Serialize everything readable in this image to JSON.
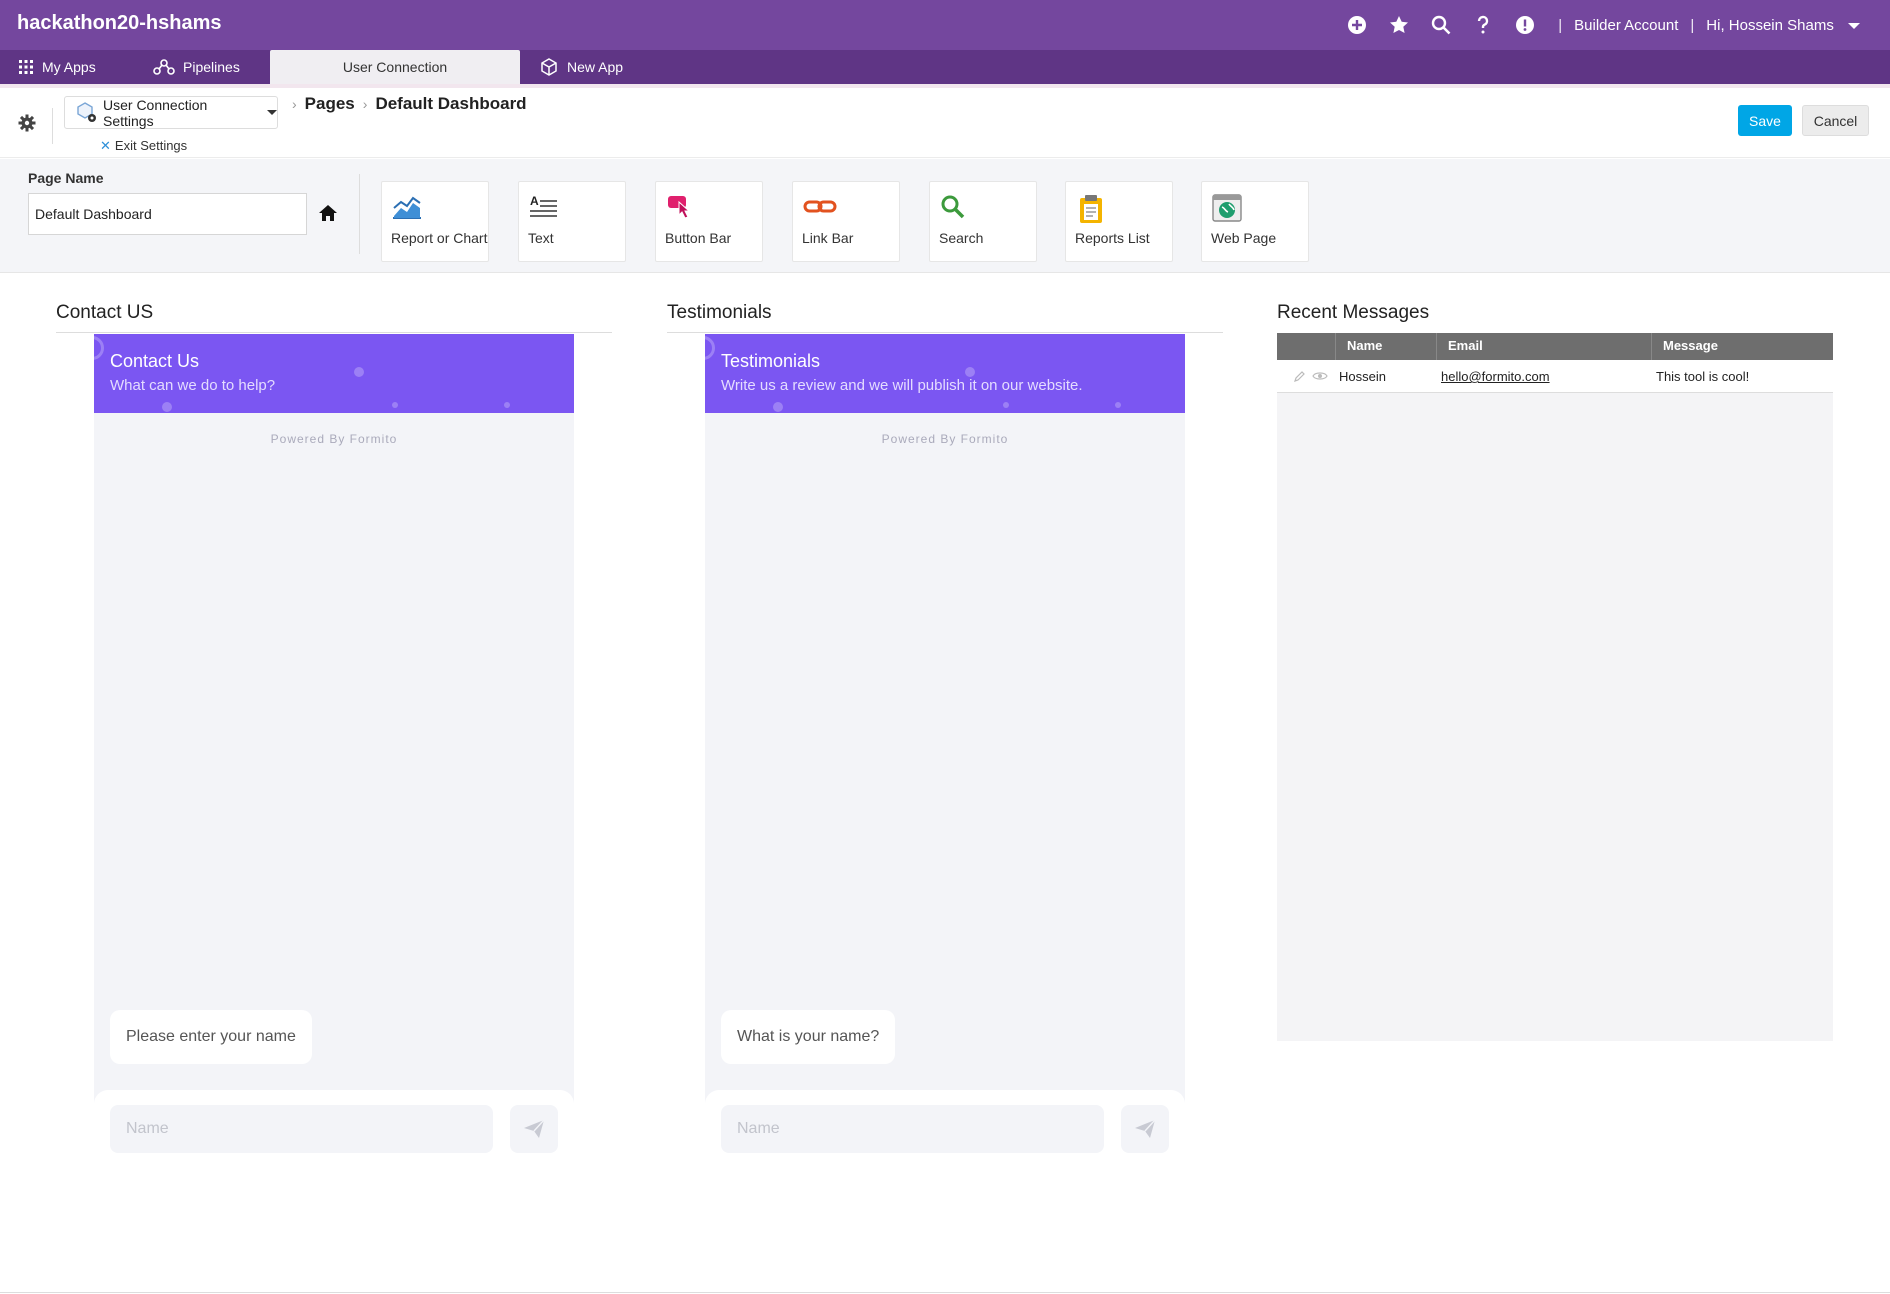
{
  "app": {
    "name": "hackathon20-hshams",
    "account_label": "Builder Account",
    "user_greeting": "Hi, Hossein Shams",
    "separator": "|",
    "icons": [
      "add-circle-icon",
      "star-icon",
      "search-icon",
      "help-icon",
      "alert-icon"
    ]
  },
  "tabs": [
    {
      "label": "My Apps",
      "icon": "grid-icon"
    },
    {
      "label": "Pipelines",
      "icon": "pipelines-icon"
    },
    {
      "label": "User Connection",
      "active": true
    },
    {
      "label": "New App",
      "icon": "cube-icon"
    }
  ],
  "settings": {
    "connection_select": "User Connection Settings",
    "exit_label": "Exit Settings",
    "breadcrumb": [
      "Pages",
      "Default Dashboard"
    ],
    "save_label": "Save",
    "cancel_label": "Cancel"
  },
  "widgets": {
    "page_name_label": "Page Name",
    "page_name_value": "Default Dashboard",
    "items": [
      {
        "label": "Report or Chart",
        "icon": "chart-icon"
      },
      {
        "label": "Text",
        "icon": "text-icon"
      },
      {
        "label": "Button Bar",
        "icon": "button-bar-icon"
      },
      {
        "label": "Link Bar",
        "icon": "link-icon"
      },
      {
        "label": "Search",
        "icon": "search-icon"
      },
      {
        "label": "Reports List",
        "icon": "clipboard-icon"
      },
      {
        "label": "Web Page",
        "icon": "globe-icon"
      }
    ]
  },
  "panels": {
    "contact": {
      "title": "Contact US",
      "form_title": "Contact Us",
      "form_subtitle": "What can we do to help?",
      "powered": "Powered By Formito",
      "question": "Please enter your name",
      "input_placeholder": "Name"
    },
    "testimonials": {
      "title": "Testimonials",
      "form_title": "Testimonials",
      "form_subtitle": "Write us a review and we will publish it on our website.",
      "powered": "Powered By Formito",
      "question": "What is your name?",
      "input_placeholder": "Name"
    },
    "recent": {
      "title": "Recent Messages",
      "columns": [
        "Name",
        "Email",
        "Message"
      ],
      "rows": [
        {
          "name": "Hossein",
          "email": "hello@formito.com",
          "message": "This tool is cool!"
        }
      ]
    }
  },
  "colors": {
    "topbar": "#74479e",
    "tabbar": "#5f3585",
    "form_header": "#7b56f2",
    "save_button": "#00a6e6"
  }
}
